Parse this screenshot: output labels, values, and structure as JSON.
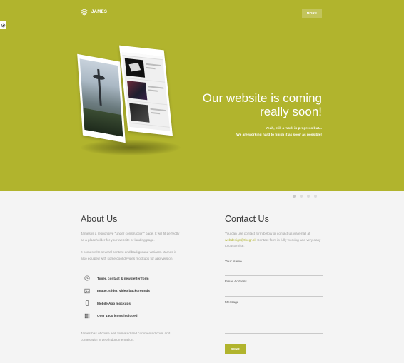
{
  "header": {
    "logo_text": "JAMES",
    "more_label": "MORE"
  },
  "hero": {
    "headline_line1": "Our website is coming",
    "headline_line2": "really soon!",
    "sub_line1": "Yeah, still a work in progress but...",
    "sub_line2": "We are working hard to finish it as soon as possible!",
    "slider_dots": 4,
    "background_color": "#b1b42d"
  },
  "about": {
    "title": "About Us",
    "para1": "James is a responsive \"under construction\" page. It will fit perfectly as a placeholder for your website or landing page.",
    "para2": "It comes with several content and background variants. James is also equiped with some cool devices mockups for app version.",
    "features": [
      {
        "icon": "clock-icon",
        "label": "Timer, contact & newsletter form"
      },
      {
        "icon": "image-icon",
        "label": "Image, slider, video backgrounds"
      },
      {
        "icon": "mobile-icon",
        "label": "Mobile App mockups"
      },
      {
        "icon": "grid-icon",
        "label": "Over 1500 icons included"
      }
    ],
    "para3": "James has of corse well formated and commented code and comes with in depth documentation."
  },
  "contact": {
    "title": "Contact Us",
    "intro_prefix": "You can use contact form below or contact us via email at",
    "email": "webdesign@thegr.pl",
    "intro_suffix": ". Contact form is fully working and very easy to customise.",
    "name_label": "Your Name",
    "email_label": "Email Address",
    "message_label": "Message",
    "send_label": "SEND"
  },
  "colors": {
    "accent": "#b1b42d",
    "text_dark": "#3a3a3a",
    "text_muted": "#9a9a9a",
    "background": "#f4f4f4"
  }
}
